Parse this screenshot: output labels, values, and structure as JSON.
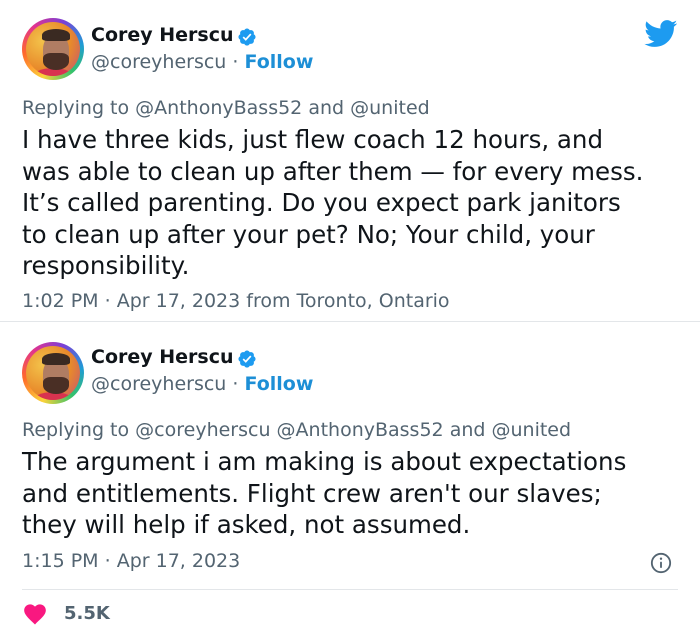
{
  "tweets": [
    {
      "author": {
        "name": "Corey Herscu",
        "handle": "@coreyherscu"
      },
      "follow_label": "Follow",
      "separator": "·",
      "reply": {
        "prefix": "Replying to",
        "mentions": "@AnthonyBass52",
        "conjunction": "and",
        "last_mention": "@united"
      },
      "text_lines": [
        "I have three kids, just flew coach 12 hours, and",
        "was able to clean up after them — for every mess.",
        "It’s called parenting. Do you expect park janitors",
        "to clean up after your pet? No; Your child, your",
        "responsibility."
      ],
      "meta": {
        "time": "1:02 PM",
        "date": "Apr 17, 2023",
        "location": "from Toronto, Ontario"
      }
    },
    {
      "author": {
        "name": "Corey Herscu",
        "handle": "@coreyherscu"
      },
      "follow_label": "Follow",
      "separator": "·",
      "reply": {
        "prefix": "Replying to",
        "mentions": "@coreyherscu @AnthonyBass52",
        "conjunction": "and",
        "last_mention": "@united"
      },
      "text_lines": [
        "The argument i am making is about expectations",
        "and entitlements. Flight crew aren't our slaves;",
        "they will help if asked, not assumed."
      ],
      "meta": {
        "time": "1:15 PM",
        "date": "Apr 17, 2023"
      },
      "likes": "5.5K"
    }
  ],
  "icons": {
    "brand": "twitter-bird-icon",
    "verified": "verified-badge-icon",
    "info": "info-icon",
    "like": "heart-icon"
  },
  "colors": {
    "twitter_blue": "#1d9bf0",
    "follow_link": "#1d8fd6",
    "secondary_text": "#536471",
    "primary_text": "#0f1419",
    "heart": "#f91880",
    "divider": "#e3e6e9"
  }
}
